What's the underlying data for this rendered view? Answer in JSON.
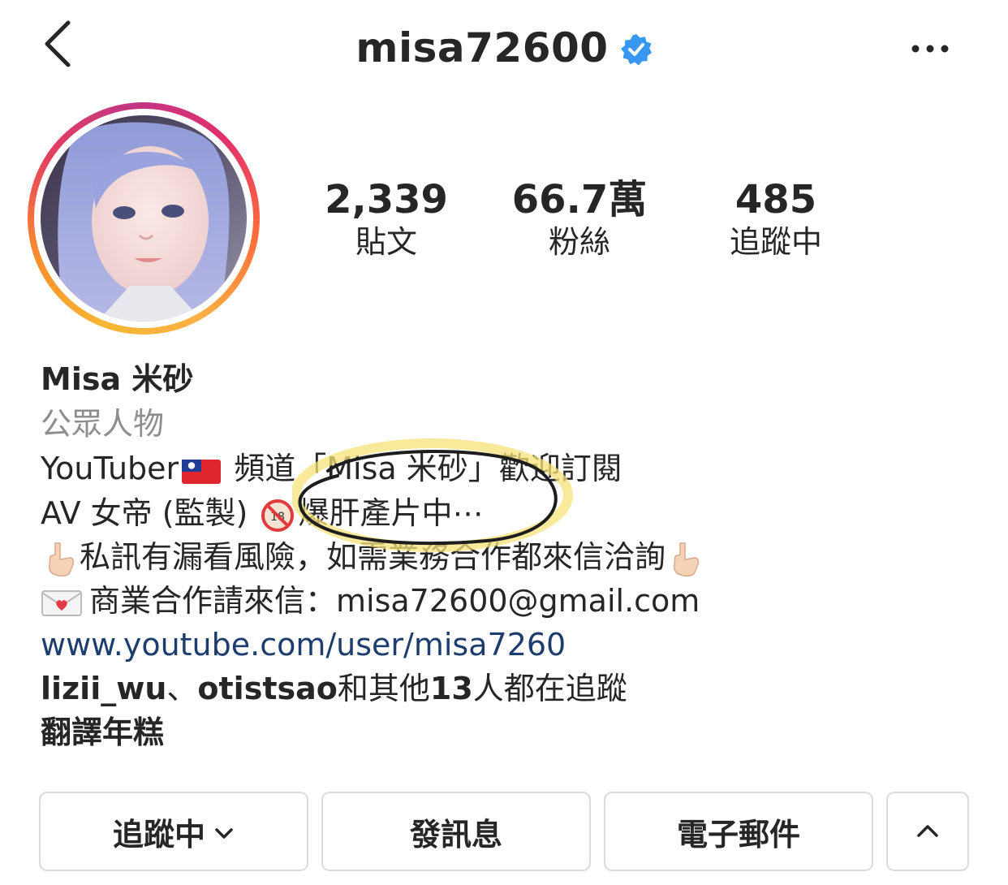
{
  "header": {
    "username": "misa72600",
    "verified": true,
    "back_icon": "chevron-left-icon",
    "more_icon": "more-horizontal-icon"
  },
  "stats": {
    "posts": {
      "value": "2,339",
      "label": "貼文"
    },
    "followers": {
      "value": "66.7萬",
      "label": "粉絲"
    },
    "following": {
      "value": "485",
      "label": "追蹤中"
    }
  },
  "profile": {
    "display_name": "Misa 米砂",
    "category": "公眾人物",
    "bio": {
      "line1_a": "YouTuber",
      "line1_b": " 頻道「Misa 米砂」歡迎訂閱",
      "line2_a": "AV 女帝 (監製) ",
      "line2_b": "爆肝產片中⋯",
      "line3": "私訊有漏看風險，如需業務合作都來信洽詢",
      "line4": "商業合作請來信：misa72600@gmail.com"
    },
    "link": "www.youtube.com/user/misa7260",
    "followed_by": {
      "user1": "lizii_wu",
      "sep": "、",
      "user2": "otistsao",
      "text": "和其他",
      "count": "13",
      "suffix": "人都在追蹤"
    },
    "translate": "翻譯年糕"
  },
  "buttons": {
    "following": "追蹤中",
    "message": "發訊息",
    "email": "電子郵件"
  },
  "colors": {
    "verified_blue": "#3897f0",
    "link_blue": "#1c3d6e",
    "muted_gray": "#8e8e8e",
    "highlight_yellow": "#f5e27a"
  }
}
